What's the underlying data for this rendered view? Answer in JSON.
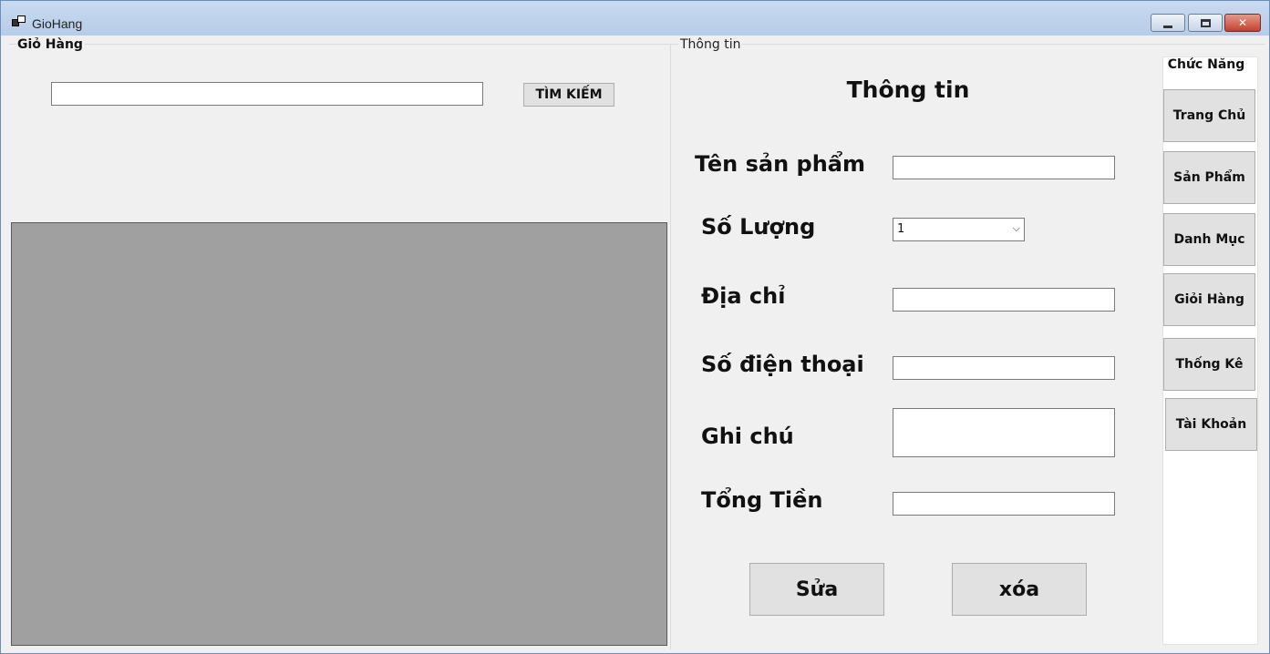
{
  "window": {
    "title": "GioHang"
  },
  "cart_group": {
    "legend": "Giỏ Hàng",
    "search_value": "",
    "search_button": "TÌM KIẾM"
  },
  "info_group": {
    "legend": "Thông tin",
    "heading": "Thông tin",
    "fields": {
      "product_name": {
        "label": "Tên sản phẩm",
        "value": ""
      },
      "quantity": {
        "label": "Số Lượng",
        "value": "1"
      },
      "address": {
        "label": "Địa chỉ",
        "value": ""
      },
      "phone": {
        "label": "Số điện thoại",
        "value": ""
      },
      "note": {
        "label": "Ghi chú",
        "value": ""
      },
      "total": {
        "label": "Tổng Tiền",
        "value": ""
      }
    },
    "edit_button": "Sửa",
    "delete_button": "xóa"
  },
  "functions": {
    "title": "Chức Năng",
    "items": [
      "Trang Chủ",
      "Sản Phẩm",
      "Danh Mục",
      "Giỏi Hàng",
      "Thống Kê",
      "Tài Khoản"
    ]
  }
}
